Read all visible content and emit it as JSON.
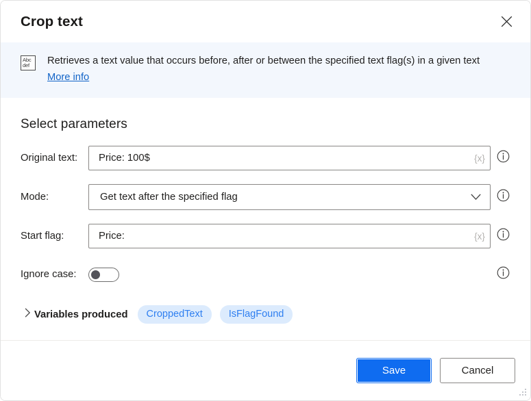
{
  "window": {
    "title": "Crop text",
    "close_icon": "close-icon"
  },
  "banner": {
    "icon_top": "Abc",
    "icon_bottom": "def",
    "description": "Retrieves a text value that occurs before, after or between the specified text flag(s) in a given text",
    "link_label": "More info"
  },
  "parameters": {
    "section_title": "Select parameters",
    "fields": [
      {
        "label": "Original text:",
        "value": "Price: 100$",
        "variable_button": "{x}",
        "info_icon": "info-icon"
      },
      {
        "label": "Mode:",
        "value": "Get text after the specified flag",
        "chevron_icon": "chevron-down-icon",
        "info_icon": "info-icon"
      },
      {
        "label": "Start flag:",
        "value": "Price:",
        "variable_button": "{x}",
        "info_icon": "info-icon"
      }
    ],
    "toggle": {
      "label": "Ignore case:",
      "state": "off",
      "info_icon": "info-icon"
    }
  },
  "variables_produced": {
    "caret_icon": "chevron-right-icon",
    "label": "Variables produced",
    "items": [
      {
        "name": "CroppedText"
      },
      {
        "name": "IsFlagFound"
      }
    ]
  },
  "footer": {
    "save_label": "Save",
    "cancel_label": "Cancel",
    "resize_grip": "resize-grip-icon"
  },
  "colors": {
    "accent": "#0f6cf0",
    "banner_bg": "#f3f7fd",
    "link": "#1264c8",
    "pill_bg": "#dcebfd",
    "pill_text": "#2f7ff0",
    "border": "#8a8886"
  }
}
